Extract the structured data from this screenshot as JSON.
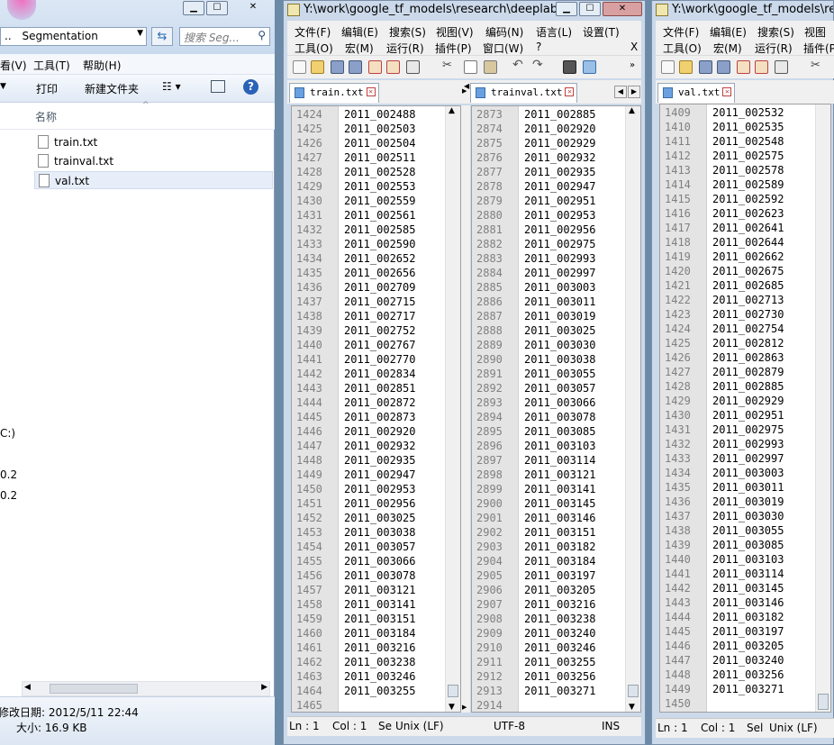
{
  "explorer": {
    "address": "Segmentation",
    "address_prefix": "..",
    "search_placeholder": "搜索 Seg...",
    "menu": [
      "看(V)",
      "工具(T)",
      "帮助(H)"
    ],
    "toolbar": {
      "print": "打印",
      "new_folder": "新建文件夹"
    },
    "column_name": "名称",
    "files": [
      "train.txt",
      "trainval.txt",
      "val.txt"
    ],
    "left_labels": {
      "drive": "C:)",
      "v1": "0.2",
      "v2": "0.2"
    },
    "status": {
      "modified": "修改日期: 2012/5/11 22:44",
      "size": "大小: 16.9 KB"
    }
  },
  "editors": [
    {
      "title": "Y:\\work\\google_tf_models\\research\\deeplab\\...",
      "menu_row1": [
        "文件(F)",
        "编辑(E)",
        "搜索(S)",
        "视图(V)",
        "编码(N)",
        "语言(L)",
        "设置(T)"
      ],
      "menu_row2": [
        "工具(O)",
        "宏(M)",
        "运行(R)",
        "插件(P)",
        "窗口(W)",
        "?"
      ],
      "menu_close": "X",
      "tabs_left": [
        "train.txt"
      ],
      "tabs_right": [
        "trainval.txt"
      ],
      "left_pane": {
        "start": 1424,
        "lines": [
          "2011_002488",
          "2011_002503",
          "2011_002504",
          "2011_002511",
          "2011_002528",
          "2011_002553",
          "2011_002559",
          "2011_002561",
          "2011_002585",
          "2011_002590",
          "2011_002652",
          "2011_002656",
          "2011_002709",
          "2011_002715",
          "2011_002717",
          "2011_002752",
          "2011_002767",
          "2011_002770",
          "2011_002834",
          "2011_002851",
          "2011_002872",
          "2011_002873",
          "2011_002920",
          "2011_002932",
          "2011_002935",
          "2011_002947",
          "2011_002953",
          "2011_002956",
          "2011_003025",
          "2011_003038",
          "2011_003057",
          "2011_003066",
          "2011_003078",
          "2011_003121",
          "2011_003141",
          "2011_003151",
          "2011_003184",
          "2011_003216",
          "2011_003238",
          "2011_003246",
          "2011_003255",
          ""
        ]
      },
      "right_pane": {
        "start": 2873,
        "lines": [
          "2011_002885",
          "2011_002920",
          "2011_002929",
          "2011_002932",
          "2011_002935",
          "2011_002947",
          "2011_002951",
          "2011_002953",
          "2011_002956",
          "2011_002975",
          "2011_002993",
          "2011_002997",
          "2011_003003",
          "2011_003011",
          "2011_003019",
          "2011_003025",
          "2011_003030",
          "2011_003038",
          "2011_003055",
          "2011_003057",
          "2011_003066",
          "2011_003078",
          "2011_003085",
          "2011_003103",
          "2011_003114",
          "2011_003121",
          "2011_003141",
          "2011_003145",
          "2011_003146",
          "2011_003151",
          "2011_003182",
          "2011_003184",
          "2011_003197",
          "2011_003205",
          "2011_003216",
          "2011_003238",
          "2011_003240",
          "2011_003246",
          "2011_003255",
          "2011_003256",
          "2011_003271",
          ""
        ]
      },
      "status": {
        "ln": "Ln : 1",
        "col": "Col : 1",
        "se": "Se",
        "eol": "Unix (LF)",
        "enc": "UTF-8",
        "ins": "INS"
      }
    },
    {
      "title": "Y:\\work\\google_tf_models\\rese",
      "menu_row1": [
        "文件(F)",
        "编辑(E)",
        "搜索(S)",
        "视图"
      ],
      "menu_row2": [
        "工具(O)",
        "宏(M)",
        "运行(R)",
        "插件(P"
      ],
      "tabs": [
        "val.txt"
      ],
      "pane": {
        "start": 1409,
        "lines": [
          "2011_002532",
          "2011_002535",
          "2011_002548",
          "2011_002575",
          "2011_002578",
          "2011_002589",
          "2011_002592",
          "2011_002623",
          "2011_002641",
          "2011_002644",
          "2011_002662",
          "2011_002675",
          "2011_002685",
          "2011_002713",
          "2011_002730",
          "2011_002754",
          "2011_002812",
          "2011_002863",
          "2011_002879",
          "2011_002885",
          "2011_002929",
          "2011_002951",
          "2011_002975",
          "2011_002993",
          "2011_002997",
          "2011_003003",
          "2011_003011",
          "2011_003019",
          "2011_003030",
          "2011_003055",
          "2011_003085",
          "2011_003103",
          "2011_003114",
          "2011_003145",
          "2011_003146",
          "2011_003182",
          "2011_003197",
          "2011_003205",
          "2011_003240",
          "2011_003256",
          "2011_003271",
          ""
        ]
      },
      "status": {
        "ln": "Ln : 1",
        "col": "Col : 1",
        "sel": "Sel",
        "eol": "Unix (LF)"
      }
    }
  ],
  "colors": {
    "titlebar": "#cbd9ea",
    "gutter": "#e4e4e4",
    "desktop": "#6a8aa8"
  }
}
